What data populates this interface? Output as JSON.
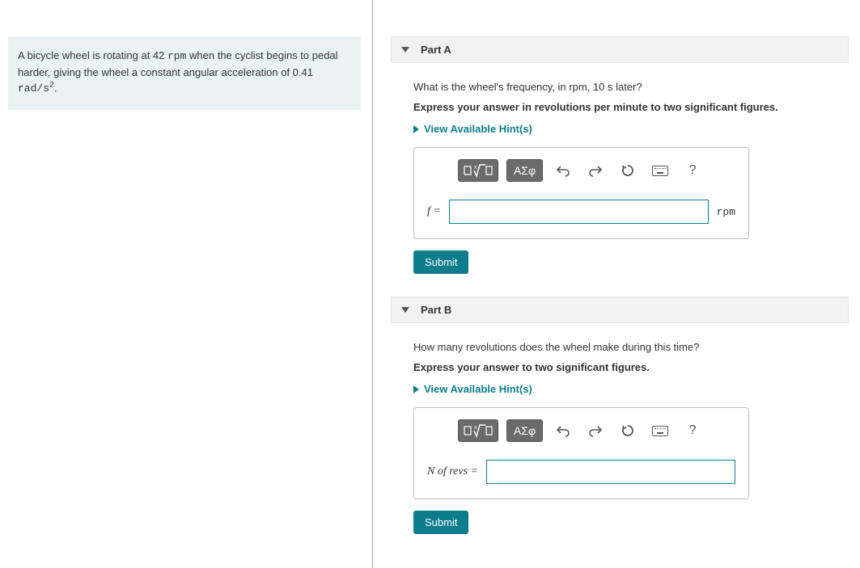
{
  "problem": {
    "text_pre": "A bicycle wheel is rotating at 42 ",
    "unit1": "rpm",
    "text_mid": " when the cyclist begins to pedal harder, giving the wheel a constant angular acceleration of 0.41 ",
    "unit2": "rad/s",
    "sup": "2",
    "text_end": "."
  },
  "parts": [
    {
      "title": "Part A",
      "question": "What is the wheel's frequency, in rpm, 10 s later?",
      "instruction": "Express your answer in revolutions per minute to two significant figures.",
      "hints_label": "View Available Hint(s)",
      "var_label_html": "f =",
      "unit_after": "rpm",
      "submit": "Submit"
    },
    {
      "title": "Part B",
      "question": "How many revolutions does the wheel make during this time?",
      "instruction": "Express your answer to two significant figures.",
      "hints_label": "View Available Hint(s)",
      "var_label_html": "N of revs =",
      "unit_after": "",
      "submit": "Submit"
    }
  ],
  "toolbar": {
    "greek": "ΑΣφ",
    "help": "?"
  }
}
